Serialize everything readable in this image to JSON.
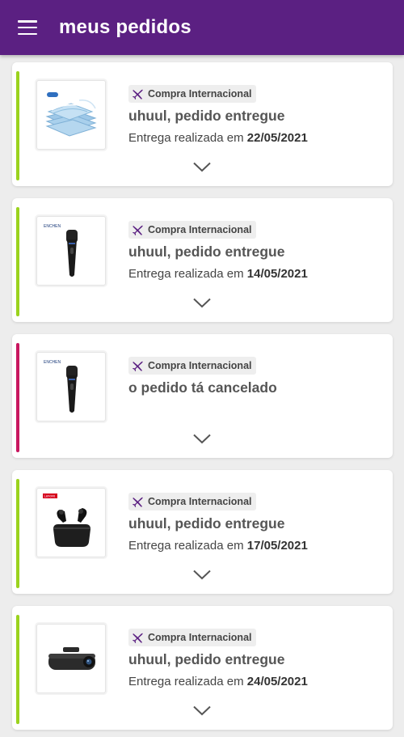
{
  "header": {
    "title": "meus pedidos"
  },
  "orders": [
    {
      "badge": "Compra Internacional",
      "status": "uhuul, pedido entregue",
      "delivery_prefix": "Entrega realizada em",
      "delivery_date": "22/05/2021",
      "status_color": "#9bd31e",
      "product_image": "face-masks"
    },
    {
      "badge": "Compra Internacional",
      "status": "uhuul, pedido entregue",
      "delivery_prefix": "Entrega realizada em",
      "delivery_date": "14/05/2021",
      "status_color": "#9bd31e",
      "product_image": "electric-shaver",
      "image_logo": "ENCHEN"
    },
    {
      "badge": "Compra Internacional",
      "status": "o pedido tá cancelado",
      "delivery_prefix": "",
      "delivery_date": "",
      "status_color": "#c8175f",
      "product_image": "electric-shaver",
      "image_logo": "ENCHEN"
    },
    {
      "badge": "Compra Internacional",
      "status": "uhuul, pedido entregue",
      "delivery_prefix": "Entrega realizada em",
      "delivery_date": "17/05/2021",
      "status_color": "#9bd31e",
      "product_image": "wireless-earbuds",
      "image_logo": "Lenovo"
    },
    {
      "badge": "Compra Internacional",
      "status": "uhuul, pedido entregue",
      "delivery_prefix": "Entrega realizada em",
      "delivery_date": "24/05/2021",
      "status_color": "#9bd31e",
      "product_image": "dash-cam"
    }
  ],
  "colors": {
    "header": "#5b2082",
    "delivered": "#9bd31e",
    "canceled": "#c8175f",
    "badge_icon": "#5b2082"
  }
}
